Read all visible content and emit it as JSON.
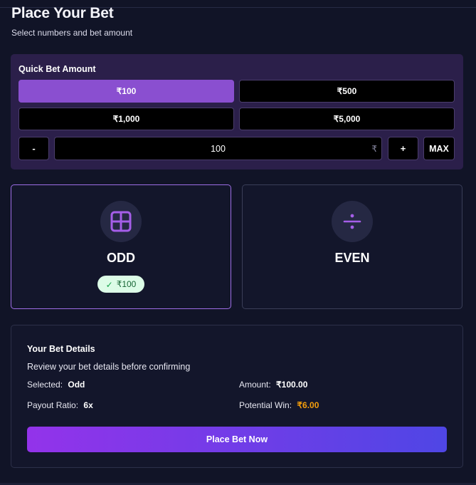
{
  "header": {
    "title": "Place Your Bet",
    "subtitle": "Select numbers and bet amount"
  },
  "quick_bet": {
    "title": "Quick Bet Amount",
    "options": [
      "₹100",
      "₹500",
      "₹1,000",
      "₹5,000"
    ],
    "selected_option": "₹100",
    "minus_label": "-",
    "plus_label": "+",
    "max_label": "MAX",
    "amount_value": "100",
    "currency_symbol": "₹"
  },
  "choices": [
    {
      "label": "ODD",
      "icon": "grid-icon",
      "selected": true,
      "badge": "₹100"
    },
    {
      "label": "EVEN",
      "icon": "divide-icon",
      "selected": false
    }
  ],
  "details": {
    "title": "Your Bet Details",
    "subtitle": "Review your bet details before confirming",
    "selected_label": "Selected:",
    "selected_value": "Odd",
    "amount_label": "Amount:",
    "amount_value": "₹100.00",
    "payout_label": "Payout Ratio:",
    "payout_value": "6x",
    "win_label": "Potential Win:",
    "win_value": "₹6.00",
    "button_label": "Place Bet Now"
  },
  "colors": {
    "background": "#111427",
    "panel": "#2b1f4a",
    "accent": "#8a4fd0",
    "win_amount": "#f59e0b",
    "badge_bg": "#dcfce7"
  }
}
